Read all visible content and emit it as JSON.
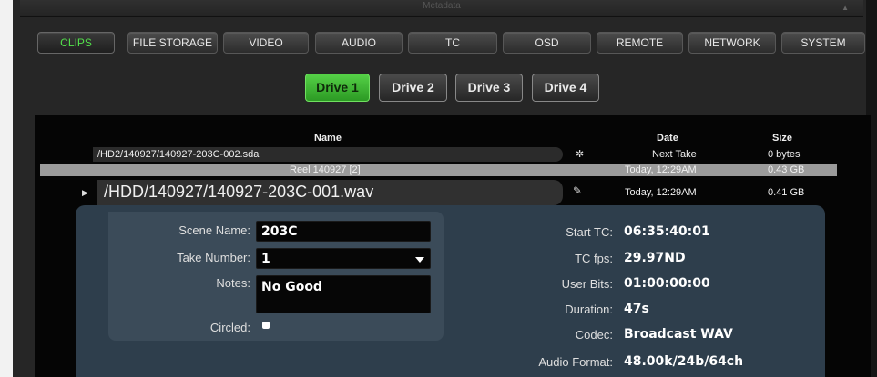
{
  "top_bar": {
    "title": "Metadata"
  },
  "tabs": [
    {
      "label": "CLIPS",
      "active": true
    },
    {
      "label": "FILE STORAGE",
      "active": false
    },
    {
      "label": "VIDEO",
      "active": false
    },
    {
      "label": "AUDIO",
      "active": false
    },
    {
      "label": "TC",
      "active": false
    },
    {
      "label": "OSD",
      "active": false
    },
    {
      "label": "REMOTE",
      "active": false
    },
    {
      "label": "NETWORK",
      "active": false
    },
    {
      "label": "SYSTEM",
      "active": false
    }
  ],
  "drives": [
    {
      "label": "Drive 1",
      "active": true
    },
    {
      "label": "Drive 2",
      "active": false
    },
    {
      "label": "Drive 3",
      "active": false
    },
    {
      "label": "Drive 4",
      "active": false
    }
  ],
  "columns": {
    "name": "Name",
    "date": "Date",
    "size": "Size"
  },
  "next_take": {
    "name": "/HD2/140927/140927-203C-002.sda",
    "date": "Next Take",
    "size": "0 bytes"
  },
  "reel_row": {
    "name": "Reel 140927 [2]",
    "date": "Today, 12:29AM",
    "size": "0.43 GB"
  },
  "current_file": {
    "name": "/HDD/140927/140927-203C-001.wav",
    "date": "Today, 12:29AM",
    "size": "0.41 GB"
  },
  "form": {
    "scene_name_label": "Scene Name:",
    "scene_name_value": "203C",
    "take_number_label": "Take Number:",
    "take_number_value": "1",
    "notes_label": "Notes:",
    "notes_value": "No Good",
    "circled_label": "Circled:"
  },
  "info": {
    "start_tc_label": "Start TC:",
    "start_tc_value": "06:35:40:01",
    "tc_fps_label": "TC fps:",
    "tc_fps_value": "29.97ND",
    "user_bits_label": "User Bits:",
    "user_bits_value": "01:00:00:00",
    "duration_label": "Duration:",
    "duration_value": "47s",
    "codec_label": "Codec:",
    "codec_value": "Broadcast WAV",
    "audio_format_label": "Audio Format:",
    "audio_format_value": "48.00k/24b/64ch"
  },
  "icons": {
    "gear": "gear-icon",
    "pencil": "pencil-icon",
    "play": "play-icon",
    "dropdown": "chevron-down-icon",
    "top_arrow": "arrow-up-icon"
  },
  "colors": {
    "accent_green": "#52e04a",
    "panel_blue": "#2e3e4c"
  }
}
